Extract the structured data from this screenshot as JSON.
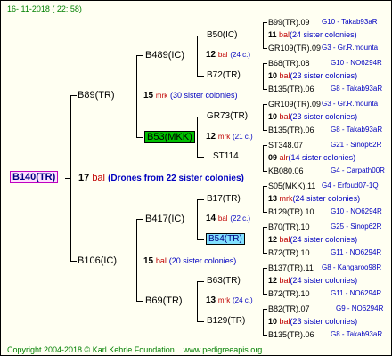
{
  "header": {
    "date": "16- 11-2018 ( 22: 58)"
  },
  "root": {
    "id": "B140(TR)",
    "count": "17",
    "unit": "bal",
    "note": "(Drones from 22 sister colonies)"
  },
  "level1": [
    {
      "id": "B89(TR)",
      "count": "15",
      "unit": "mrk",
      "note": "(30 sister colonies)"
    },
    {
      "id": "B106(IC)",
      "count": "15",
      "unit": "bal",
      "note": "(20 sister colonies)"
    }
  ],
  "level2": [
    {
      "id": "B489(IC)",
      "count": "12",
      "unit": "bal",
      "note": "(24 c.)"
    },
    {
      "id": "B53(MKK)",
      "count": "12",
      "unit": "mrk",
      "note": "(21 c.)"
    },
    {
      "id": "B417(IC)",
      "count": "14",
      "unit": "bal",
      "note": "(22 c.)"
    },
    {
      "id": "B69(TR)",
      "count": "13",
      "unit": "mrk",
      "note": "(24 c.)"
    }
  ],
  "level3": [
    "B50(IC)",
    "B72(TR)",
    "GR73(TR)",
    "ST114",
    "B17(TR)",
    "B54(TR)",
    "B63(TR)",
    "B129(TR)"
  ],
  "level4": [
    {
      "top": "B99(TR).09",
      "top_g": "G10 - Takab93aR",
      "count": "11",
      "unit": "bal",
      "note": "(24 sister colonies)",
      "bot": "GR109(TR).09",
      "bot_g": "G3 - Gr.R.mounta"
    },
    {
      "top": "B68(TR).08",
      "top_g": "G10 - NO6294R",
      "count": "10",
      "unit": "bal",
      "note": "(23 sister colonies)",
      "bot": "B135(TR).06",
      "bot_g": "G8 - Takab93aR"
    },
    {
      "top": "GR109(TR).09",
      "top_g": "G3 - Gr.R.mounta",
      "count": "10",
      "unit": "bal",
      "note": "(23 sister colonies)",
      "bot": "B135(TR).06",
      "bot_g": "G8 - Takab93aR"
    },
    {
      "top": "ST348.07",
      "top_g": "G21 - Sinop62R",
      "count": "09",
      "unit": "alr",
      "note": "(14 sister colonies)",
      "bot": "KB080.06",
      "bot_g": "G4 - Carpath00R"
    },
    {
      "top": "S05(MKK).11",
      "top_g": "G4 - Erfoud07-1Q",
      "count": "13",
      "unit": "mrk",
      "note": "(24 sister colonies)",
      "bot": "B129(TR).10",
      "bot_g": "G10 - NO6294R"
    },
    {
      "top": "B70(TR).10",
      "top_g": "G25 - Sinop62R",
      "count": "12",
      "unit": "bal",
      "note": "(24 sister colonies)",
      "bot": "B72(TR).10",
      "bot_g": "G11 - NO6294R"
    },
    {
      "top": "B137(TR).11",
      "top_g": "G8 - Kangaroo98R",
      "count": "12",
      "unit": "bal",
      "note": "(24 sister colonies)",
      "bot": "B72(TR).10",
      "bot_g": "G11 - NO6294R"
    },
    {
      "top": "B82(TR).07",
      "top_g": "G9 - NO6294R",
      "count": "10",
      "unit": "bal",
      "note": "(23 sister colonies)",
      "bot": "B135(TR).06",
      "bot_g": "G8 - Takab93aR"
    }
  ],
  "footer": {
    "copyright": "Copyright 2004-2018 © Karl Kehrle Foundation",
    "site": "www.pedigreeapis.org"
  }
}
